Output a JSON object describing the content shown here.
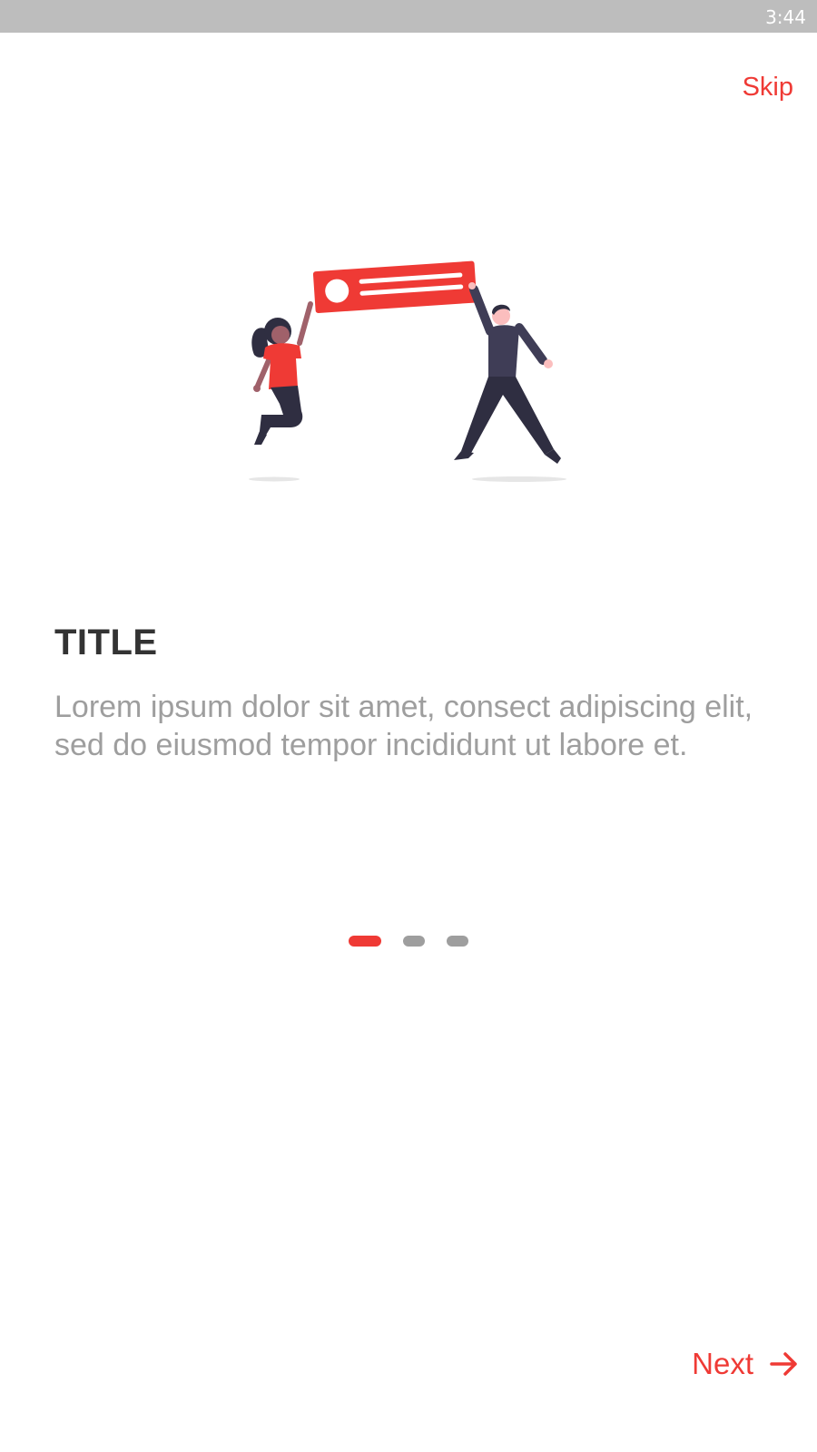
{
  "status_bar": {
    "time": "3:44"
  },
  "header": {
    "skip_label": "Skip"
  },
  "illustration": {
    "icon": "people-holding-banner-illustration"
  },
  "content": {
    "title": "TITLE",
    "description": "Lorem ipsum dolor sit amet, consect adipiscing elit, sed do eiusmod tempor incididunt ut labore et."
  },
  "pager": {
    "page_count": 3,
    "current_page": 1
  },
  "footer": {
    "next_label": "Next",
    "next_icon": "arrow-right-icon"
  },
  "colors": {
    "accent": "#ef3a35",
    "title": "#333333",
    "body_text": "#9e9e9e",
    "status_bar": "#bdbdbd",
    "figure_dark": "#2f2e41",
    "figure_skin_light": "#fbbebe",
    "figure_skin_dark": "#a0616a"
  }
}
